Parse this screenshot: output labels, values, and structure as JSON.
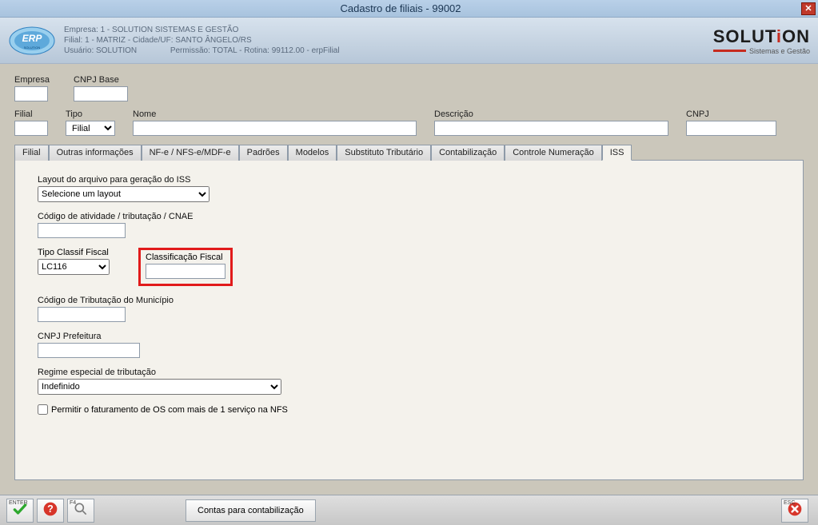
{
  "window": {
    "title": "Cadastro de filiais - 99002"
  },
  "header": {
    "line1": "Empresa: 1 - SOLUTION SISTEMAS E GESTÃO",
    "line2": "Filial: 1 - MATRIZ - Cidade/UF: SANTO ÂNGELO/RS",
    "line3_left": "Usuário: SOLUTION",
    "line3_right": "Permissão: TOTAL - Rotina: 99112.00 - erpFilial",
    "brand_main": "SOLUT",
    "brand_i": "i",
    "brand_end": "ON",
    "brand_sub": "Sistemas e Gestão"
  },
  "form": {
    "empresa_label": "Empresa",
    "cnpj_base_label": "CNPJ Base",
    "filial_label": "Filial",
    "tipo_label": "Tipo",
    "tipo_value": "Filial",
    "nome_label": "Nome",
    "descricao_label": "Descrição",
    "cnpj_label": "CNPJ"
  },
  "tabs": [
    {
      "label": "Filial"
    },
    {
      "label": "Outras informações"
    },
    {
      "label": "NF-e / NFS-e/MDF-e"
    },
    {
      "label": "Padrões"
    },
    {
      "label": "Modelos"
    },
    {
      "label": "Substituto Tributário"
    },
    {
      "label": "Contabilização"
    },
    {
      "label": "Controle Numeração"
    },
    {
      "label": "ISS"
    }
  ],
  "iss": {
    "layout_label": "Layout do arquivo para geração do ISS",
    "layout_value": "Selecione um layout",
    "codigo_atividade_label": "Código de atividade / tributação / CNAE",
    "tipo_classif_label": "Tipo Classif Fiscal",
    "tipo_classif_value": "LC116",
    "class_fiscal_label": "Classificação Fiscal",
    "codigo_trib_label": "Código de Tributação do Município",
    "cnpj_pref_label": "CNPJ Prefeitura",
    "regime_label": "Regime especial de tributação",
    "regime_value": "Indefinido",
    "checkbox_label": "Permitir o faturamento de OS com mais de 1 serviço na NFS"
  },
  "footer": {
    "enter_tag": "ENTER",
    "f4_tag": "F4",
    "esc_tag": "ESC",
    "contas_label": "Contas para contabilização"
  }
}
